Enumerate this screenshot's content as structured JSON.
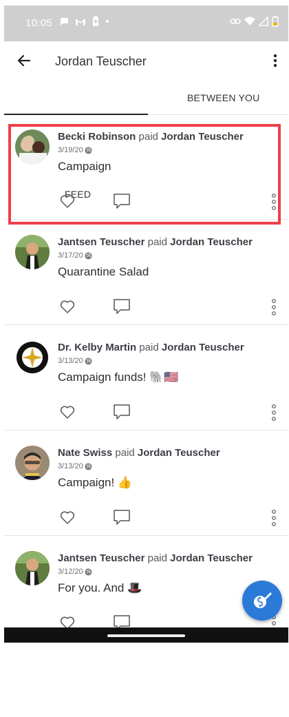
{
  "status_bar": {
    "time": "10:05",
    "icons_left": [
      "chat-icon",
      "gmail-icon",
      "battery-saver-icon",
      "dot-icon"
    ],
    "icons_right": [
      "link-icon",
      "wifi-icon",
      "signal-icon",
      "battery-low-icon"
    ],
    "battery_color": "#f2b600"
  },
  "app_bar": {
    "title": "Jordan Teuscher"
  },
  "tabs": [
    {
      "label": "FEED",
      "active": true
    },
    {
      "label": "BETWEEN YOU",
      "active": false
    }
  ],
  "feed": {
    "items": [
      {
        "payer": "Becki Robinson",
        "verb": "paid",
        "payee": "Jordan Teuscher",
        "date": "3/19/20",
        "note": "Campaign",
        "highlighted": true
      },
      {
        "payer": "Jantsen Teuscher",
        "verb": "paid",
        "payee": "Jordan Teuscher",
        "date": "3/17/20",
        "note": "Quarantine Salad",
        "highlighted": false
      },
      {
        "payer": "Dr. Kelby Martin",
        "verb": "paid",
        "payee": "Jordan Teuscher",
        "date": "3/13/20",
        "note": "Campaign funds! 🐘🇺🇸",
        "highlighted": false
      },
      {
        "payer": "Nate Swiss",
        "verb": "paid",
        "payee": "Jordan Teuscher",
        "date": "3/13/20",
        "note": "Campaign! 👍",
        "highlighted": false
      },
      {
        "payer": "Jantsen Teuscher",
        "verb": "paid",
        "payee": "Jordan Teuscher",
        "date": "3/12/20",
        "note": "For you. And 🎩",
        "highlighted": false
      }
    ]
  },
  "colors": {
    "accent": "#2c7ad8",
    "highlight_border": "#ef3f4a",
    "status_bar": "#cfcfcf"
  },
  "fab": {
    "icon": "pay-or-request-icon"
  }
}
